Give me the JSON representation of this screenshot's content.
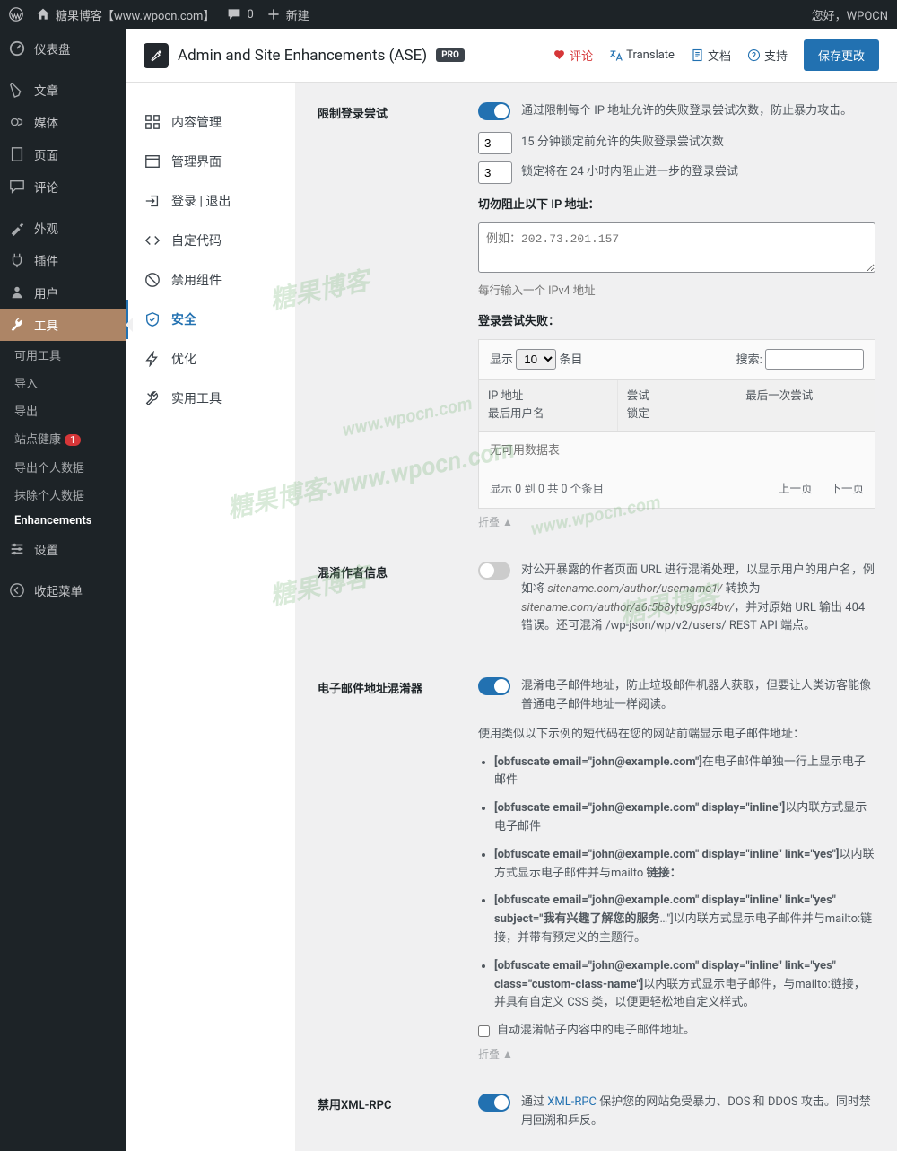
{
  "adminbar": {
    "site_name": "糖果博客【www.wpocn.com】",
    "comments": "0",
    "new": "新建",
    "greeting": "您好，WPOCN"
  },
  "adminmenu": {
    "dashboard": "仪表盘",
    "posts": "文章",
    "media": "媒体",
    "pages": "页面",
    "comments": "评论",
    "appearance": "外观",
    "plugins": "插件",
    "users": "用户",
    "tools": "工具",
    "sub_available": "可用工具",
    "sub_import": "导入",
    "sub_export": "导出",
    "sub_health": "站点健康",
    "sub_health_badge": "1",
    "sub_export_data": "导出个人数据",
    "sub_erase_data": "抹除个人数据",
    "sub_enhancements": "Enhancements",
    "settings": "设置",
    "collapse": "收起菜单"
  },
  "header": {
    "title": "Admin and Site Enhancements (ASE)",
    "pro": "PRO",
    "review": "评论",
    "translate": "Translate",
    "docs": "文档",
    "support": "支持",
    "save": "保存更改"
  },
  "tabs": {
    "content": "内容管理",
    "admin_ui": "管理界面",
    "login": "登录 | 退出",
    "code": "自定代码",
    "disable": "禁用组件",
    "security": "安全",
    "optimize": "优化",
    "utilities": "实用工具"
  },
  "limit_login": {
    "label": "限制登录尝试",
    "desc": "通过限制每个 IP 地址允许的失败登录尝试次数，防止暴力攻击。",
    "attempts_val": "3",
    "attempts_txt": "15 分钟锁定前允许的失败登录尝试次数",
    "lockout_val": "3",
    "lockout_txt": "锁定将在 24 小时内阻止进一步的登录尝试",
    "ip_whitelist_label": "切勿阻止以下 IP 地址：",
    "ip_placeholder": "例如：202.73.201.157",
    "ip_hint": "每行输入一个 IPv4 地址",
    "failures_label": "登录尝试失败：",
    "dt_show": "显示",
    "dt_show_val": "10",
    "dt_entries": "条目",
    "dt_search": "搜索:",
    "dt_col_ip": "IP 地址",
    "dt_col_user": "最后用户名",
    "dt_col_attempts": "尝试",
    "dt_col_lock": "锁定",
    "dt_col_last": "最后一次尝试",
    "dt_empty": "无可用数据表",
    "dt_info": "显示 0 到 0 共 0 个条目",
    "dt_prev": "上一页",
    "dt_next": "下一页",
    "collapse": "折叠 ▲"
  },
  "obfuscate_author": {
    "label": "混淆作者信息",
    "desc1": "对公开暴露的作者页面 URL 进行混淆处理，以显示用户的用户名，例如将 ",
    "ex1": "sitename.com/author/username1/",
    "desc2": " 转换为 ",
    "ex2": "sitename.com/author/a6r5b8ytu9gp34bv/",
    "desc3": "，并对原始 URL 输出 404 错误。还可混淆 /wp-json/wp/v2/users/ REST API 端点。"
  },
  "email_obf": {
    "label": "电子邮件地址混淆器",
    "desc": "混淆电子邮件地址，防止垃圾邮件机器人获取，但要让人类访客能像普通电子邮件地址一样阅读。",
    "intro": "使用类似以下示例的短代码在您的网站前端显示电子邮件地址：",
    "li1a": "[obfuscate email=\"john@example.com\"]",
    "li1b": "在电子邮件单独一行上显示电子邮件",
    "li2a": "[obfuscate email=\"john@example.com\" display=\"inline\"]",
    "li2b": "以内联方式显示电子邮件",
    "li3a": "[obfuscate email=\"john@example.com\" display=\"inline\" link=\"yes\"]",
    "li3b": "以内联方式显示电子邮件并与mailto",
    "li3c": " 链接：",
    "li4a": "[obfuscate email=\"john@example.com\" display=\"inline\" link=\"yes\" subject=\"",
    "li4b": "我有兴趣了解您的服务",
    "li4c": "…\"]以内联方式显示电子邮件并与mailto:链接，并带有预定义的主题行。",
    "li5a": "[obfuscate email=\"john@example.com\" display=\"inline\" link=\"yes\" class=\"custom-class-name\"]",
    "li5b": "以内联方式显示电子邮件，与mailto:链接，并具有自定义 CSS 类，以便更轻松地自定义样式。",
    "checkbox": "自动混淆帖子内容中的电子邮件地址。",
    "collapse": "折叠 ▲"
  },
  "xmlrpc": {
    "label": "禁用XML-RPC",
    "desc1": "通过 ",
    "link": "XML-RPC",
    "desc2": " 保护您的网站免受暴力、DOS 和 DDOS 攻击。同时禁用回溯和乒反。"
  },
  "watermark": {
    "brand": "糖果博客",
    "url": "www.wpocn.com"
  }
}
